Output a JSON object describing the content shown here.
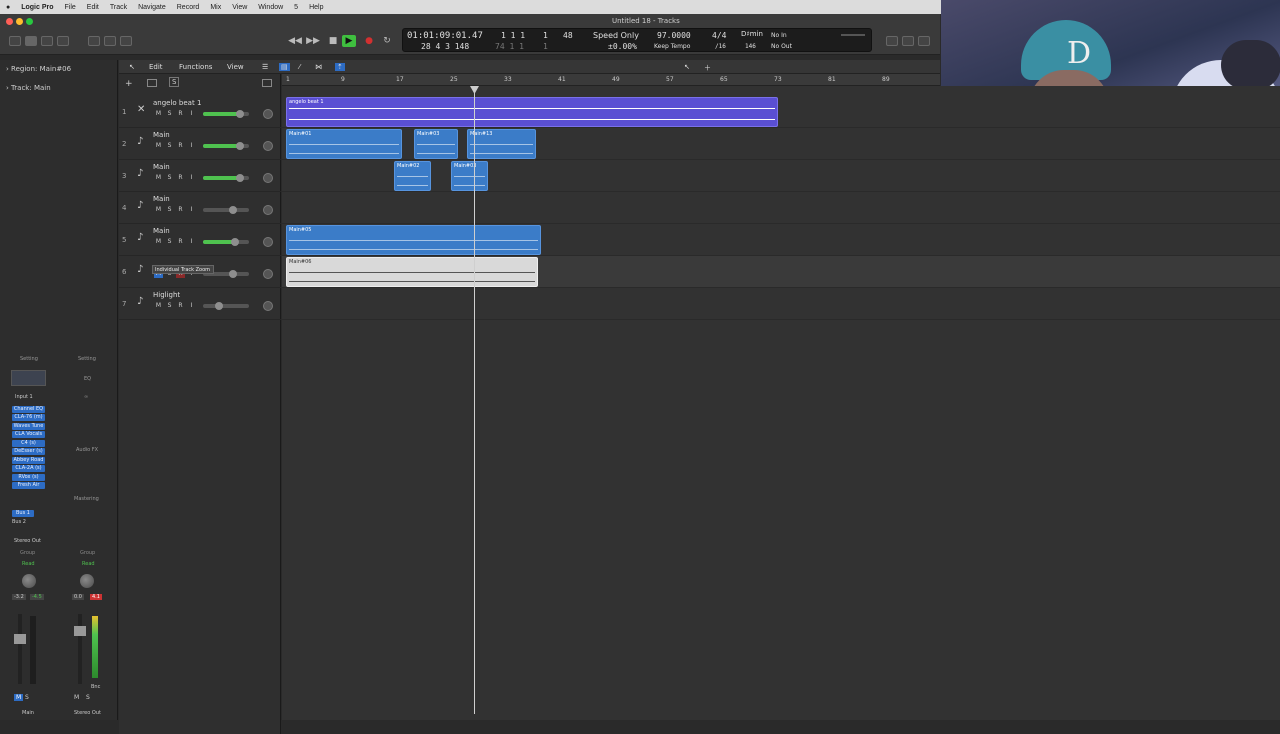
{
  "menubar": {
    "app": "Logic Pro",
    "items": [
      "File",
      "Edit",
      "Track",
      "Navigate",
      "Record",
      "Mix",
      "View",
      "Window",
      "5",
      "Help"
    ]
  },
  "window_title": "Untitled 18 - Tracks",
  "lcd": {
    "time_primary": "01:01:09:01.47",
    "beats_primary": "1  1  1",
    "beat_sub": "1",
    "bars_secondary": "28  4  3  148",
    "beats_secondary": "74  1  1",
    "beat_sub2": "1",
    "division": "48",
    "sync_mode": "Speed Only",
    "speed_pct": "±0.00%",
    "tempo": "97.0000",
    "tempo_mode": "Keep Tempo",
    "time_sig": "4/4",
    "div_label": "/16",
    "key": "D♯min",
    "key_num": "146",
    "in": "No In",
    "out": "No Out"
  },
  "inspector": {
    "region_label": "Region:",
    "region_name": "Main#06",
    "track_label": "Track:",
    "track_name": "Main",
    "setting1": "Setting",
    "setting2": "Setting",
    "eq": "EQ",
    "input": "Input 1",
    "plugins": [
      "Channel EQ",
      "CLA-76 (m)",
      "Waves Tune",
      "CLA Vocals",
      "C4 (s)",
      "DeEsser (s)",
      "Abbey Road",
      "CLA-2A (s)",
      "RVox (s)",
      "Fresh Air"
    ],
    "audio_fx": "Audio FX",
    "mastering": "Mastering",
    "sends": [
      "Bus 1",
      "Bus 2"
    ],
    "stereo_out": "Stereo Out",
    "group1": "Group",
    "group2": "Group",
    "read1": "Read",
    "read2": "Read",
    "vol1a": "-3.2",
    "vol1b": "-4.5",
    "vol2a": "0.0",
    "vol2b": "4.1",
    "ms1": [
      "M",
      "S"
    ],
    "ms2": [
      "M",
      "S"
    ],
    "bnc": "Bnc",
    "ch1_name": "Main",
    "ch2_name": "Stereo Out"
  },
  "toolbar": {
    "edit": "Edit",
    "functions": "Functions",
    "view": "View"
  },
  "ruler": {
    "bars": [
      "1",
      "9",
      "17",
      "25",
      "33",
      "41",
      "49",
      "57",
      "65",
      "73",
      "81",
      "89"
    ]
  },
  "tracks": [
    {
      "num": "1",
      "name": "angelo beat 1",
      "vol": 0.8
    },
    {
      "num": "2",
      "name": "Main",
      "vol": 0.8
    },
    {
      "num": "3",
      "name": "Main",
      "vol": 0.8
    },
    {
      "num": "4",
      "name": "Main",
      "vol": 0.65
    },
    {
      "num": "5",
      "name": "Main",
      "vol": 0.7
    },
    {
      "num": "6",
      "name": "",
      "vol": 0.65
    },
    {
      "num": "7",
      "name": "Higlight",
      "vol": 0.35
    }
  ],
  "msri": [
    "M",
    "S",
    "R",
    "I"
  ],
  "tooltip": "Individual Track Zoom",
  "regions": {
    "r1": "angelo beat 1",
    "r2a": "Main#01",
    "r2b": "Main#03",
    "r2c": "Main#13",
    "r3a": "Main#02",
    "r3b": "Main#03",
    "r5": "Main#05",
    "r6": "Main#06"
  },
  "colors": {
    "accent": "#3b7cc8",
    "play": "#3fbf3f",
    "record": "#d23030",
    "region_purple": "#5a4fd3"
  }
}
